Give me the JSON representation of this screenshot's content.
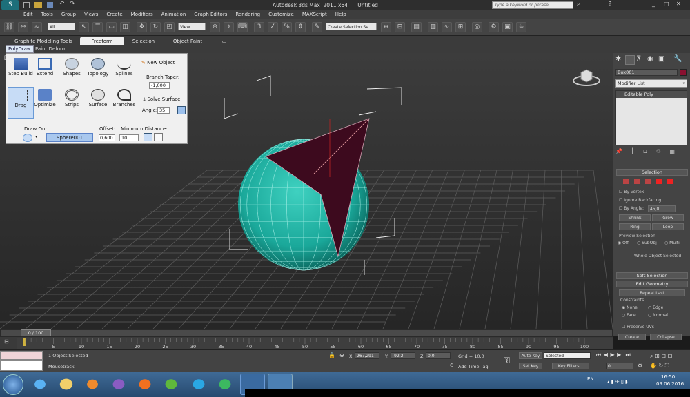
{
  "title_bar": {
    "window_title": "Autodesk 3ds Max  2011 x64      Untitled",
    "search_placeholder": "Type a keyword or phrase"
  },
  "menu": [
    "Edit",
    "Tools",
    "Group",
    "Views",
    "Create",
    "Modifiers",
    "Animation",
    "Graph Editors",
    "Rendering",
    "Customize",
    "MAXScript",
    "Help"
  ],
  "toolbar": {
    "filter_value": "All",
    "coord_value": "View",
    "selection_set": "Create Selection Se"
  },
  "ribbon": {
    "tabs": [
      "Graphite Modeling Tools",
      "Freeform",
      "Selection",
      "Object Paint"
    ],
    "subtabs": [
      "PolyDraw",
      "Paint Deform"
    ]
  },
  "freeform": {
    "tools_row1": [
      "Step Build",
      "Extend",
      "Shapes",
      "Topology",
      "Splines"
    ],
    "tools_row2": [
      "Drag",
      "Optimize",
      "Strips",
      "Surface",
      "Branches"
    ],
    "new_object": "New Object",
    "branch_taper_label": "Branch Taper:",
    "branch_taper_value": "-1,000",
    "solve_surface": "Solve Surface",
    "angle_label": "Angle:",
    "angle_value": "35",
    "draw_on_label": "Draw On:",
    "draw_on_value": "Sphere001",
    "offset_label": "Offset:",
    "offset_value": "0,600",
    "min_distance_label": "Minimum Distance:",
    "min_distance_value": "10"
  },
  "command_panel": {
    "object_name": "Box001",
    "modifier_list": "Modifier List",
    "stack_item": "Editable Poly",
    "selection_header": "Selection",
    "by_vertex": "By Vertex",
    "ignore_backfacing": "Ignore Backfacing",
    "by_angle": "By Angle:",
    "by_angle_value": "45,0",
    "shrink": "Shrink",
    "grow": "Grow",
    "ring": "Ring",
    "loop": "Loop",
    "preview_selection": "Preview Selection",
    "preview_off": "Off",
    "preview_subobj": "SubObj",
    "preview_multi": "Multi",
    "whole_object": "Whole Object Selected",
    "soft_selection": "Soft Selection",
    "edit_geometry": "Edit Geometry",
    "repeat_last": "Repeat Last",
    "constraints": "Constraints",
    "c_none": "None",
    "c_edge": "Edge",
    "c_face": "Face",
    "c_normal": "Normal",
    "preserve_uvs": "Preserve UVs",
    "create": "Create",
    "collapse": "Collapse"
  },
  "timeline": {
    "frame_counter": "0 / 100",
    "ticks": [
      "5",
      "10",
      "15",
      "20",
      "25",
      "30",
      "35",
      "40",
      "45",
      "50",
      "55",
      "60",
      "65",
      "70",
      "75",
      "80",
      "85",
      "90",
      "95",
      "100"
    ]
  },
  "status": {
    "selected_text": "1 Object Selected",
    "mousetrack": "Mousetrack",
    "x_label": "X:",
    "x_value": "267,291",
    "y_label": "Y:",
    "y_value": "-92,2",
    "z_label": "Z:",
    "z_value": "0,0",
    "grid": "Grid = 10,0",
    "add_time_tag": "Add Time Tag",
    "auto_key": "Auto Key",
    "set_key": "Set Key",
    "key_mode_value": "Selected",
    "key_filters": "Key Filters...",
    "frame_value": "0"
  },
  "taskbar": {
    "lang": "EN",
    "time": "16:50",
    "date": "09.06.2016"
  }
}
